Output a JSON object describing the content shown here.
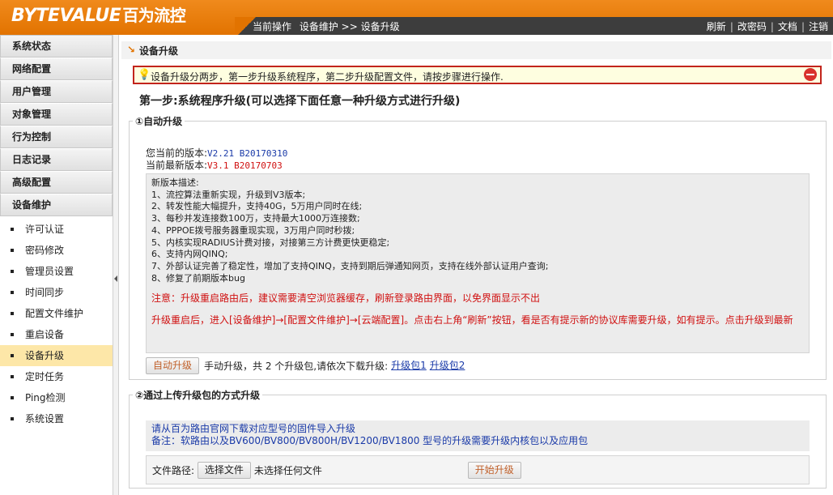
{
  "header": {
    "logo_latin": "BYTEVALUE",
    "logo_cn": "百为流控",
    "breadcrumb": [
      "当前操作",
      "设备维护 >> 设备升级"
    ],
    "links": [
      "刷新",
      "改密码",
      "文档",
      "注销"
    ]
  },
  "sidebar": {
    "categories": [
      "系统状态",
      "网络配置",
      "用户管理",
      "对象管理",
      "行为控制",
      "日志记录",
      "高级配置",
      "设备维护"
    ],
    "sub_items": [
      "许可认证",
      "密码修改",
      "管理员设置",
      "时间同步",
      "配置文件维护",
      "重启设备",
      "设备升级",
      "定时任务",
      "Ping检测",
      "系统设置"
    ],
    "active_sub": "设备升级"
  },
  "main": {
    "title": "设备升级",
    "notice": "设备升级分两步，第一步升级系统程序，第二步升级配置文件，请按步骤进行操作.",
    "step1_title": "第一步:系统程序升级(可以选择下面任意一种升级方式进行升级)",
    "auto": {
      "legend": "①自动升级",
      "current_label": "您当前的版本:",
      "current_version": "V2.21 B20170310",
      "latest_label": "当前最新版本:",
      "latest_version": "V3.1 B20170703",
      "desc_lines": [
        "新版本描述:",
        "1、流控算法重新实现，升级到V3版本;",
        "2、转发性能大幅提升，支持40G，5万用户同时在线;",
        "3、每秒并发连接数100万，支持最大1000万连接数;",
        "4、PPPOE拨号服务器重现实现，3万用户同时秒拨;",
        "5、内核实现RADIUS计费对接，对接第三方计费更快更稳定;",
        "6、支持内网QINQ;",
        "7、外部认证完善了稳定性，增加了支持QINQ，支持到期后弹通知网页，支持在线外部认证用户查询;",
        "8、修复了前期版本bug"
      ],
      "warning1": "注意：升级重启路由后，建议需要清空浏览器缓存，刷新登录路由界面，以免界面显示不出",
      "warning2": "升级重启后，进入[设备维护]→[配置文件维护]→[云端配置]。点击右上角“刷新”按钮，看是否有提示新的协议库需要升级，如有提示。点击升级到最新",
      "button": "自动升级",
      "manual_text": "手动升级，共 2 个升级包,请依次下载升级:",
      "pkg1": "升级包1",
      "pkg2": "升级包2"
    },
    "upload": {
      "legend": "②通过上传升级包的方式升级",
      "info1": "请从百为路由官网下载对应型号的固件导入升级",
      "info2": "备注：软路由以及BV600/BV800/BV800H/BV1200/BV1800 型号的升级需要升级内核包以及应用包",
      "path_label": "文件路径:",
      "choose_button": "选择文件",
      "no_file": "未选择任何文件",
      "start_button": "开始升级"
    }
  },
  "colors": {
    "brand_orange": "#e27300",
    "nav_dark": "#3d3d3d",
    "active_item": "#fde7a8",
    "warning_red": "#d01010",
    "link_blue": "#1a3aa8"
  }
}
